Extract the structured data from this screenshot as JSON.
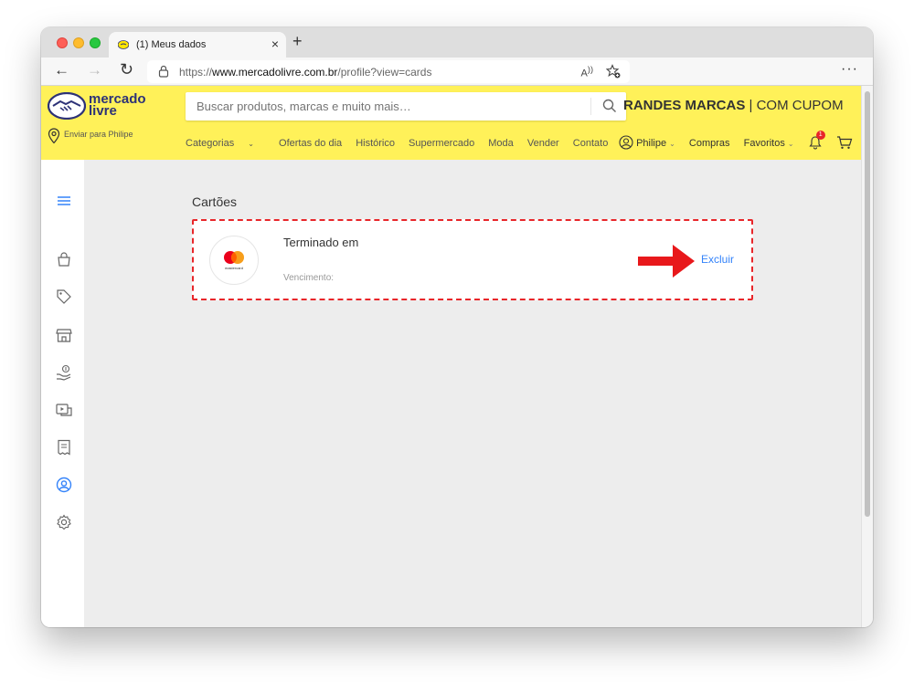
{
  "browser": {
    "tab_title": "(1) Meus dados",
    "tab_close": "×",
    "new_tab": "+",
    "url_scheme": "https://",
    "url_host": "www.mercadolivre.com.br",
    "url_path": "/profile?view=cards",
    "read_aloud": "A҂",
    "more": "···"
  },
  "header": {
    "logo_line1": "mercado",
    "logo_line2": "livre",
    "search_placeholder": "Buscar produtos, marcas e muito mais…",
    "promo_bold": "RANDES MARCAS",
    "promo_rest": " | COM CUPOM",
    "deliver_label": "Enviar para Philipe",
    "nav": {
      "categorias": "Categorias",
      "ofertas": "Ofertas do dia",
      "historico": "Histórico",
      "supermercado": "Supermercado",
      "moda": "Moda",
      "vender": "Vender",
      "contato": "Contato"
    },
    "user": {
      "name": "Philipe",
      "compras": "Compras",
      "favoritos": "Favoritos",
      "notifications_count": "1"
    }
  },
  "sidebar": {
    "icons": [
      "menu-icon",
      "bag-icon",
      "tag-icon",
      "store-icon",
      "money-hand-icon",
      "media-icon",
      "receipt-icon",
      "profile-icon",
      "gear-icon"
    ]
  },
  "main": {
    "section_title": "Cartões",
    "card": {
      "brand": "mastercard",
      "ending_label": "Terminado em",
      "expiry_label": "Vencimento:",
      "delete_label": "Excluir"
    }
  },
  "colors": {
    "brand_yellow": "#fff159",
    "link_blue": "#3483fa",
    "highlight_red": "#e8262a",
    "active_sidebar": "#3483fa"
  }
}
